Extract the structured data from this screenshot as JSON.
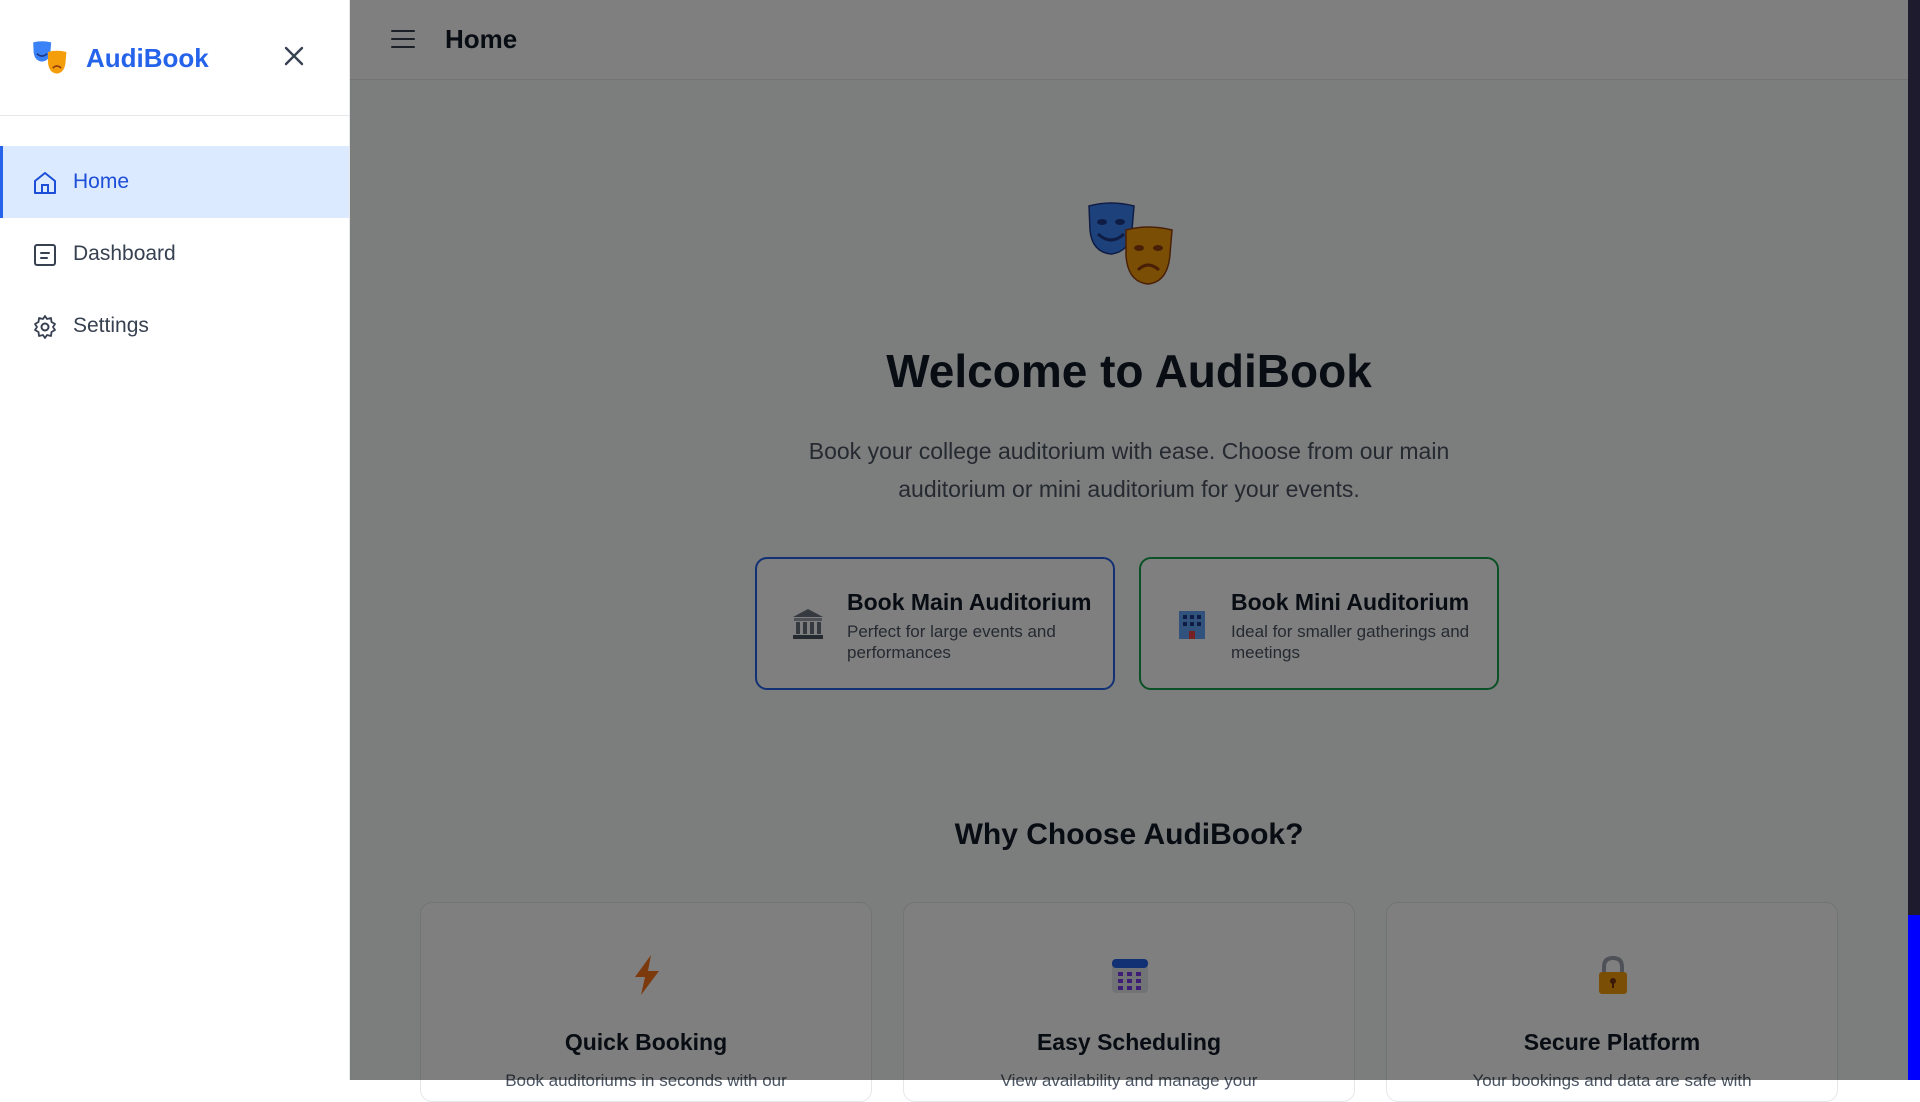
{
  "app": {
    "brand": "AudiBook"
  },
  "sidebar": {
    "items": [
      {
        "label": "Home",
        "icon": "home-icon",
        "active": true
      },
      {
        "label": "Dashboard",
        "icon": "dashboard-icon",
        "active": false
      },
      {
        "label": "Settings",
        "icon": "gear-icon",
        "active": false
      }
    ]
  },
  "header": {
    "title": "Home"
  },
  "hero": {
    "title": "Welcome to AudiBook",
    "subtitle": "Book your college auditorium with ease. Choose from our main auditorium or mini auditorium for your events."
  },
  "booking": [
    {
      "title": "Book Main Auditorium",
      "description": "Perfect for large events and performances",
      "icon": "classical-building-icon",
      "accent": "#2563eb"
    },
    {
      "title": "Book Mini Auditorium",
      "description": "Ideal for smaller gatherings and meetings",
      "icon": "office-building-icon",
      "accent": "#16a34a"
    }
  ],
  "why": {
    "title": "Why Choose AudiBook?",
    "features": [
      {
        "title": "Quick Booking",
        "description": "Book auditoriums in seconds with our",
        "icon": "lightning-icon"
      },
      {
        "title": "Easy Scheduling",
        "description": "View availability and manage your",
        "icon": "calendar-icon"
      },
      {
        "title": "Secure Platform",
        "description": "Your bookings and data are safe with",
        "icon": "lock-icon"
      }
    ]
  },
  "colors": {
    "accent": "#2563eb",
    "active_bg": "#dbeafe",
    "mini_accent": "#16a34a",
    "scroll_thumb": "#0000ff"
  }
}
